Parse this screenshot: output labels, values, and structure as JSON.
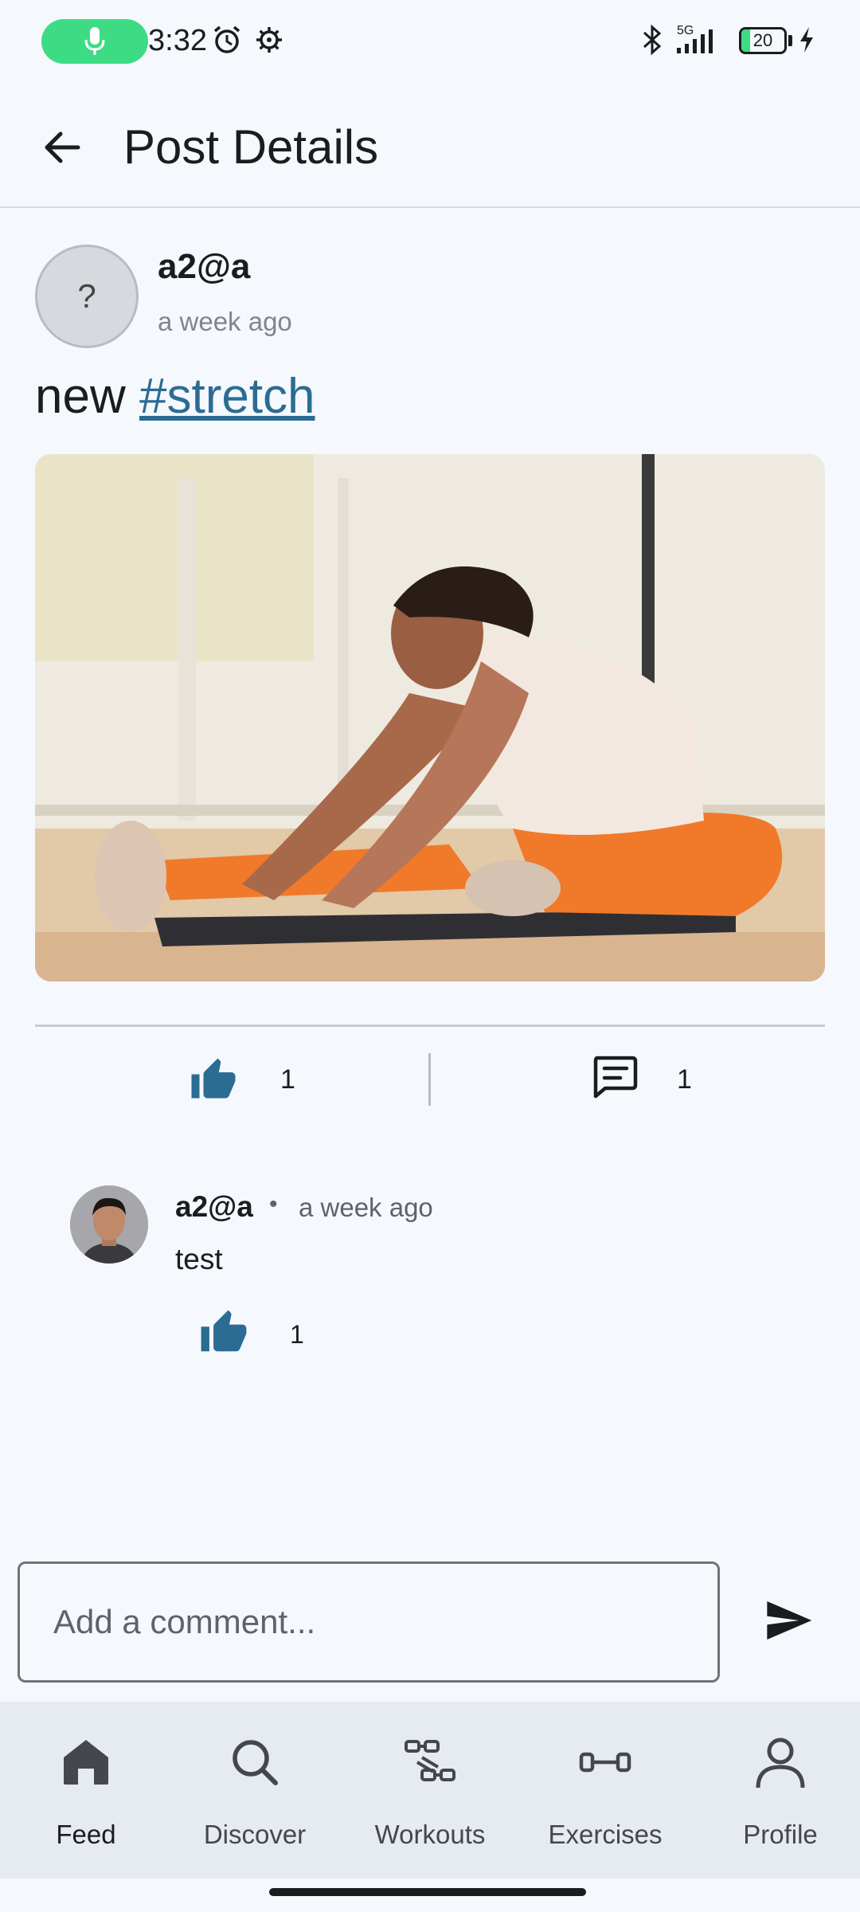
{
  "status_bar": {
    "time": "3:32",
    "network": "5G",
    "battery": "20",
    "battery_level_percent": 20,
    "icons": [
      "mic-icon",
      "alarm-icon",
      "settings-icon",
      "bluetooth-icon",
      "signal-icon",
      "battery-icon",
      "charging-icon"
    ]
  },
  "app_bar": {
    "title": "Post Details",
    "back_icon": "arrow-back-icon"
  },
  "post": {
    "avatar_placeholder": "?",
    "author": "a2@a",
    "time": "a week ago",
    "text": "new",
    "hashtag": "#stretch",
    "image_alt": "Woman in white tank top and orange leggings doing a seated forward stretch on a mat",
    "likes": "1",
    "comments": "1",
    "like_icon": "thumb-up-icon",
    "comment_icon": "comment-icon"
  },
  "comments": [
    {
      "author": "a2@a",
      "separator": "•",
      "time": "a week ago",
      "text": "test",
      "likes": "1"
    }
  ],
  "comment_input": {
    "placeholder": "Add a comment...",
    "send_icon": "send-icon"
  },
  "bottom_nav": {
    "items": [
      {
        "label": "Feed",
        "icon": "home-icon",
        "active": true
      },
      {
        "label": "Discover",
        "icon": "search-icon",
        "active": false
      },
      {
        "label": "Workouts",
        "icon": "dumbbell-icon",
        "active": false
      },
      {
        "label": "Exercises",
        "icon": "fitness-icon",
        "active": false
      },
      {
        "label": "Profile",
        "icon": "person-icon",
        "active": false
      }
    ]
  },
  "colors": {
    "background": "#f5f8fd",
    "accent": "#2b6c93",
    "mic_pill": "#3ddc84",
    "nav_background": "#e6eaf1"
  }
}
